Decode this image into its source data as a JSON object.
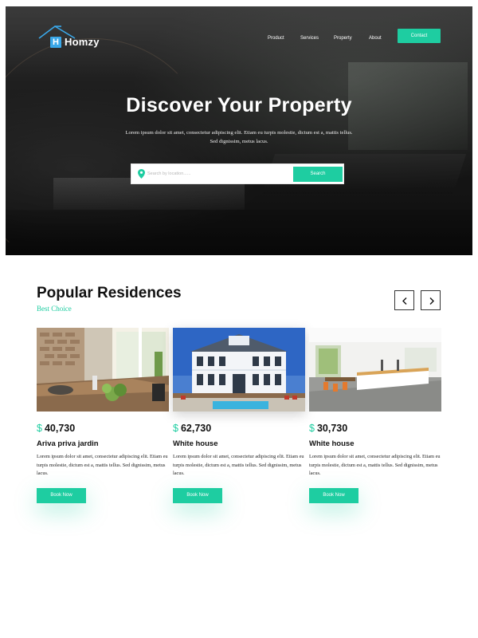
{
  "brand": {
    "logo_letter": "H",
    "name": "Homzy"
  },
  "nav": {
    "items": [
      "Product",
      "Services",
      "Property",
      "About"
    ],
    "contact_label": "Contact"
  },
  "hero": {
    "title": "Discover Your Property",
    "description": "Lorem ipsum dolor sit amet, consectetur adipiscing elit. Etiam eu turpis molestie, dictum est a, mattis tellus. Sed dignissim, metus lacus.",
    "search_placeholder": "Search by location......",
    "search_button": "Search"
  },
  "popular": {
    "title": "Popular Residences",
    "subtitle": "Best Choice",
    "cards": [
      {
        "currency": "$",
        "price": "40,730",
        "name": "Ariva priva jardin",
        "description": "Lorem ipsum dolor sit amet, consectetur adipiscing elit. Etiam eu turpis molestie, dictum est a, mattis tellus. Sed dignissim, metus lacus.",
        "button": "Book Now"
      },
      {
        "currency": "$",
        "price": "62,730",
        "name": "White house",
        "description": "Lorem ipsum dolor sit amet, consectetur adipiscing elit. Etiam eu turpis molestie, dictum est a, mattis tellus. Sed dignissim, metus lacus.",
        "button": "Book Now"
      },
      {
        "currency": "$",
        "price": "30,730",
        "name": "White house",
        "description": "Lorem ipsum dolor sit amet, consectetur adipiscing elit. Etiam eu turpis molestie, dictum est a, mattis tellus. Sed dignissim, metus lacus.",
        "button": "Book Now"
      }
    ]
  },
  "colors": {
    "accent": "#1ecda1",
    "logo_blue": "#3aa7e8",
    "text_dark": "#111111"
  }
}
